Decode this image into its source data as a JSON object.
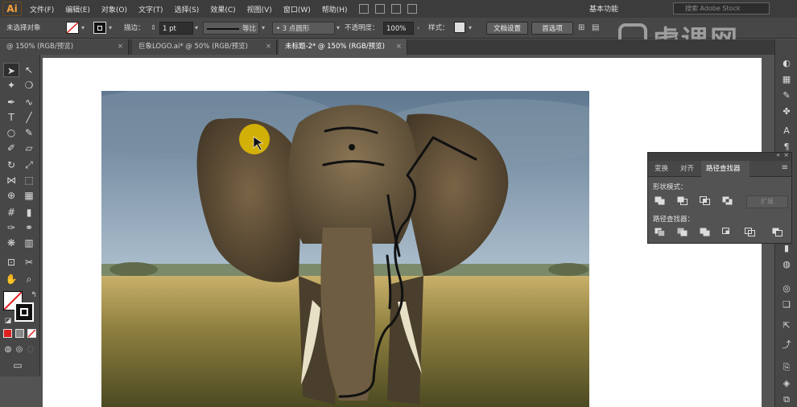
{
  "app": {
    "logo": "Ai",
    "menus": [
      "文件(F)",
      "编辑(E)",
      "对象(O)",
      "文字(T)",
      "选择(S)",
      "效果(C)",
      "视图(V)",
      "窗口(W)",
      "帮助(H)"
    ],
    "workspace": "基本功能",
    "search_placeholder": "搜索 Adobe Stock"
  },
  "watermark": {
    "text": "虎课网"
  },
  "control_bar": {
    "selection_status": "未选择对象",
    "stroke_label": "描边：",
    "stroke_value": "1 pt",
    "profile_label": "等比",
    "brush_label": "3 点圆形",
    "opacity_label": "不透明度：",
    "opacity_value": "100%",
    "style_label": "样式：",
    "doc_setup_label": "文档设置",
    "preferences_label": "首选项"
  },
  "tabs": [
    {
      "label": "@ 150% (RGB/预览)",
      "active": false
    },
    {
      "label": "巨象LOGO.ai* @ 50% (RGB/预览)",
      "active": false
    },
    {
      "label": "未标题-2* @ 150% (RGB/预览)",
      "active": true
    }
  ],
  "pathfinder_panel": {
    "tabs": [
      "变换",
      "对齐",
      "路径查找器"
    ],
    "active_tab": "路径查找器",
    "shape_modes_label": "形状模式：",
    "pathfinders_label": "路径查找器：",
    "expand_label": "扩展",
    "shape_mode_buttons": [
      "unite-icon",
      "minus-front-icon",
      "intersect-icon",
      "exclude-icon"
    ],
    "pathfinder_buttons": [
      "divide-icon",
      "trim-icon",
      "merge-icon",
      "crop-icon",
      "outline-icon",
      "minus-back-icon"
    ]
  },
  "colors": {
    "menubar": "#3c3c3c",
    "panel": "#474747",
    "workspace_bg": "#535353",
    "artboard": "#ffffff",
    "cursor_highlight": "#e6c200",
    "drawn_path": "#111111"
  }
}
